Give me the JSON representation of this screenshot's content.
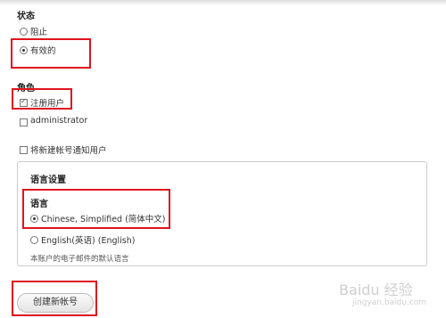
{
  "status": {
    "heading": "状态",
    "options": [
      {
        "label": "阻止",
        "selected": false
      },
      {
        "label": "有效的",
        "selected": true
      }
    ]
  },
  "roles": {
    "heading": "角色",
    "options": [
      {
        "label": "注册用户",
        "checked": true
      },
      {
        "label": "administrator",
        "checked": false
      }
    ]
  },
  "notify": {
    "label": "将新建帐号通知用户",
    "checked": false
  },
  "language": {
    "legend": "语言设置",
    "heading": "语言",
    "options": [
      {
        "label": "Chinese, Simplified (简体中文)",
        "selected": true
      },
      {
        "label": "English(英语) (English)",
        "selected": false
      }
    ],
    "description": "本账户的电子邮件的默认语言"
  },
  "submit_label": "创建新帐号",
  "watermark": {
    "brand": "Baidu 经验",
    "url": "jingyan.baidu.com"
  },
  "colors": {
    "highlight": "#e0141e"
  }
}
